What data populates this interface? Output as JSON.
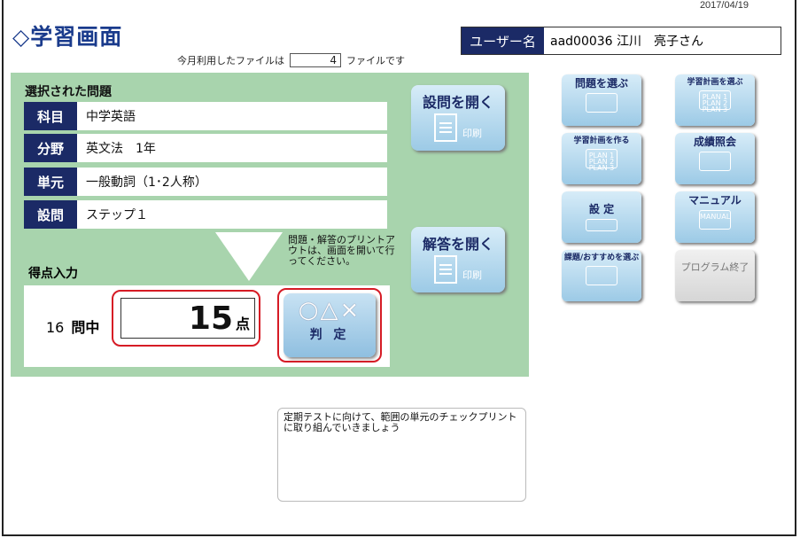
{
  "date": "2017/04/19",
  "app_title": "◇学習画面",
  "usage": {
    "prefix": "今月利用したファイルは",
    "count": "4",
    "suffix": "ファイルです"
  },
  "user": {
    "label": "ユーザー名",
    "value": "aad00036 江川　亮子さん"
  },
  "selected": {
    "title": "選択された問題",
    "rows": [
      {
        "key": "科目",
        "value": "中学英語"
      },
      {
        "key": "分野",
        "value": "英文法　1年"
      },
      {
        "key": "単元",
        "value": "一般動詞（1･2人称）"
      },
      {
        "key": "設問",
        "value": "ステップ１"
      }
    ]
  },
  "buttons": {
    "open_question": "設問を開く",
    "open_answer": "解答を開く",
    "print": "印刷",
    "judge_symbols": "○△×",
    "judge_label": "判 定"
  },
  "note": "問題・解答のプリントアウトは、画面を開いて行ってください。",
  "score": {
    "label": "得点入力",
    "total": "16",
    "total_unit": "問中",
    "value": "15",
    "unit": "点"
  },
  "side_menu": {
    "choose_problem": "問題を選ぶ",
    "choose_plan": "学習計画を選ぶ",
    "make_plan": "学習計画を作る",
    "grades": "成績照会",
    "settings": "設 定",
    "manual": "マニュアル",
    "recommend": "課題/おすすめを選ぶ",
    "exit": "プログラム終了",
    "plan_lines": "PLAN 1 PLAN 2 PLAN 3",
    "manual_icon_text": "MANUAL"
  },
  "memo": "定期テストに向けて、範囲の単元のチェックプリントに取り組んでいきましょう"
}
